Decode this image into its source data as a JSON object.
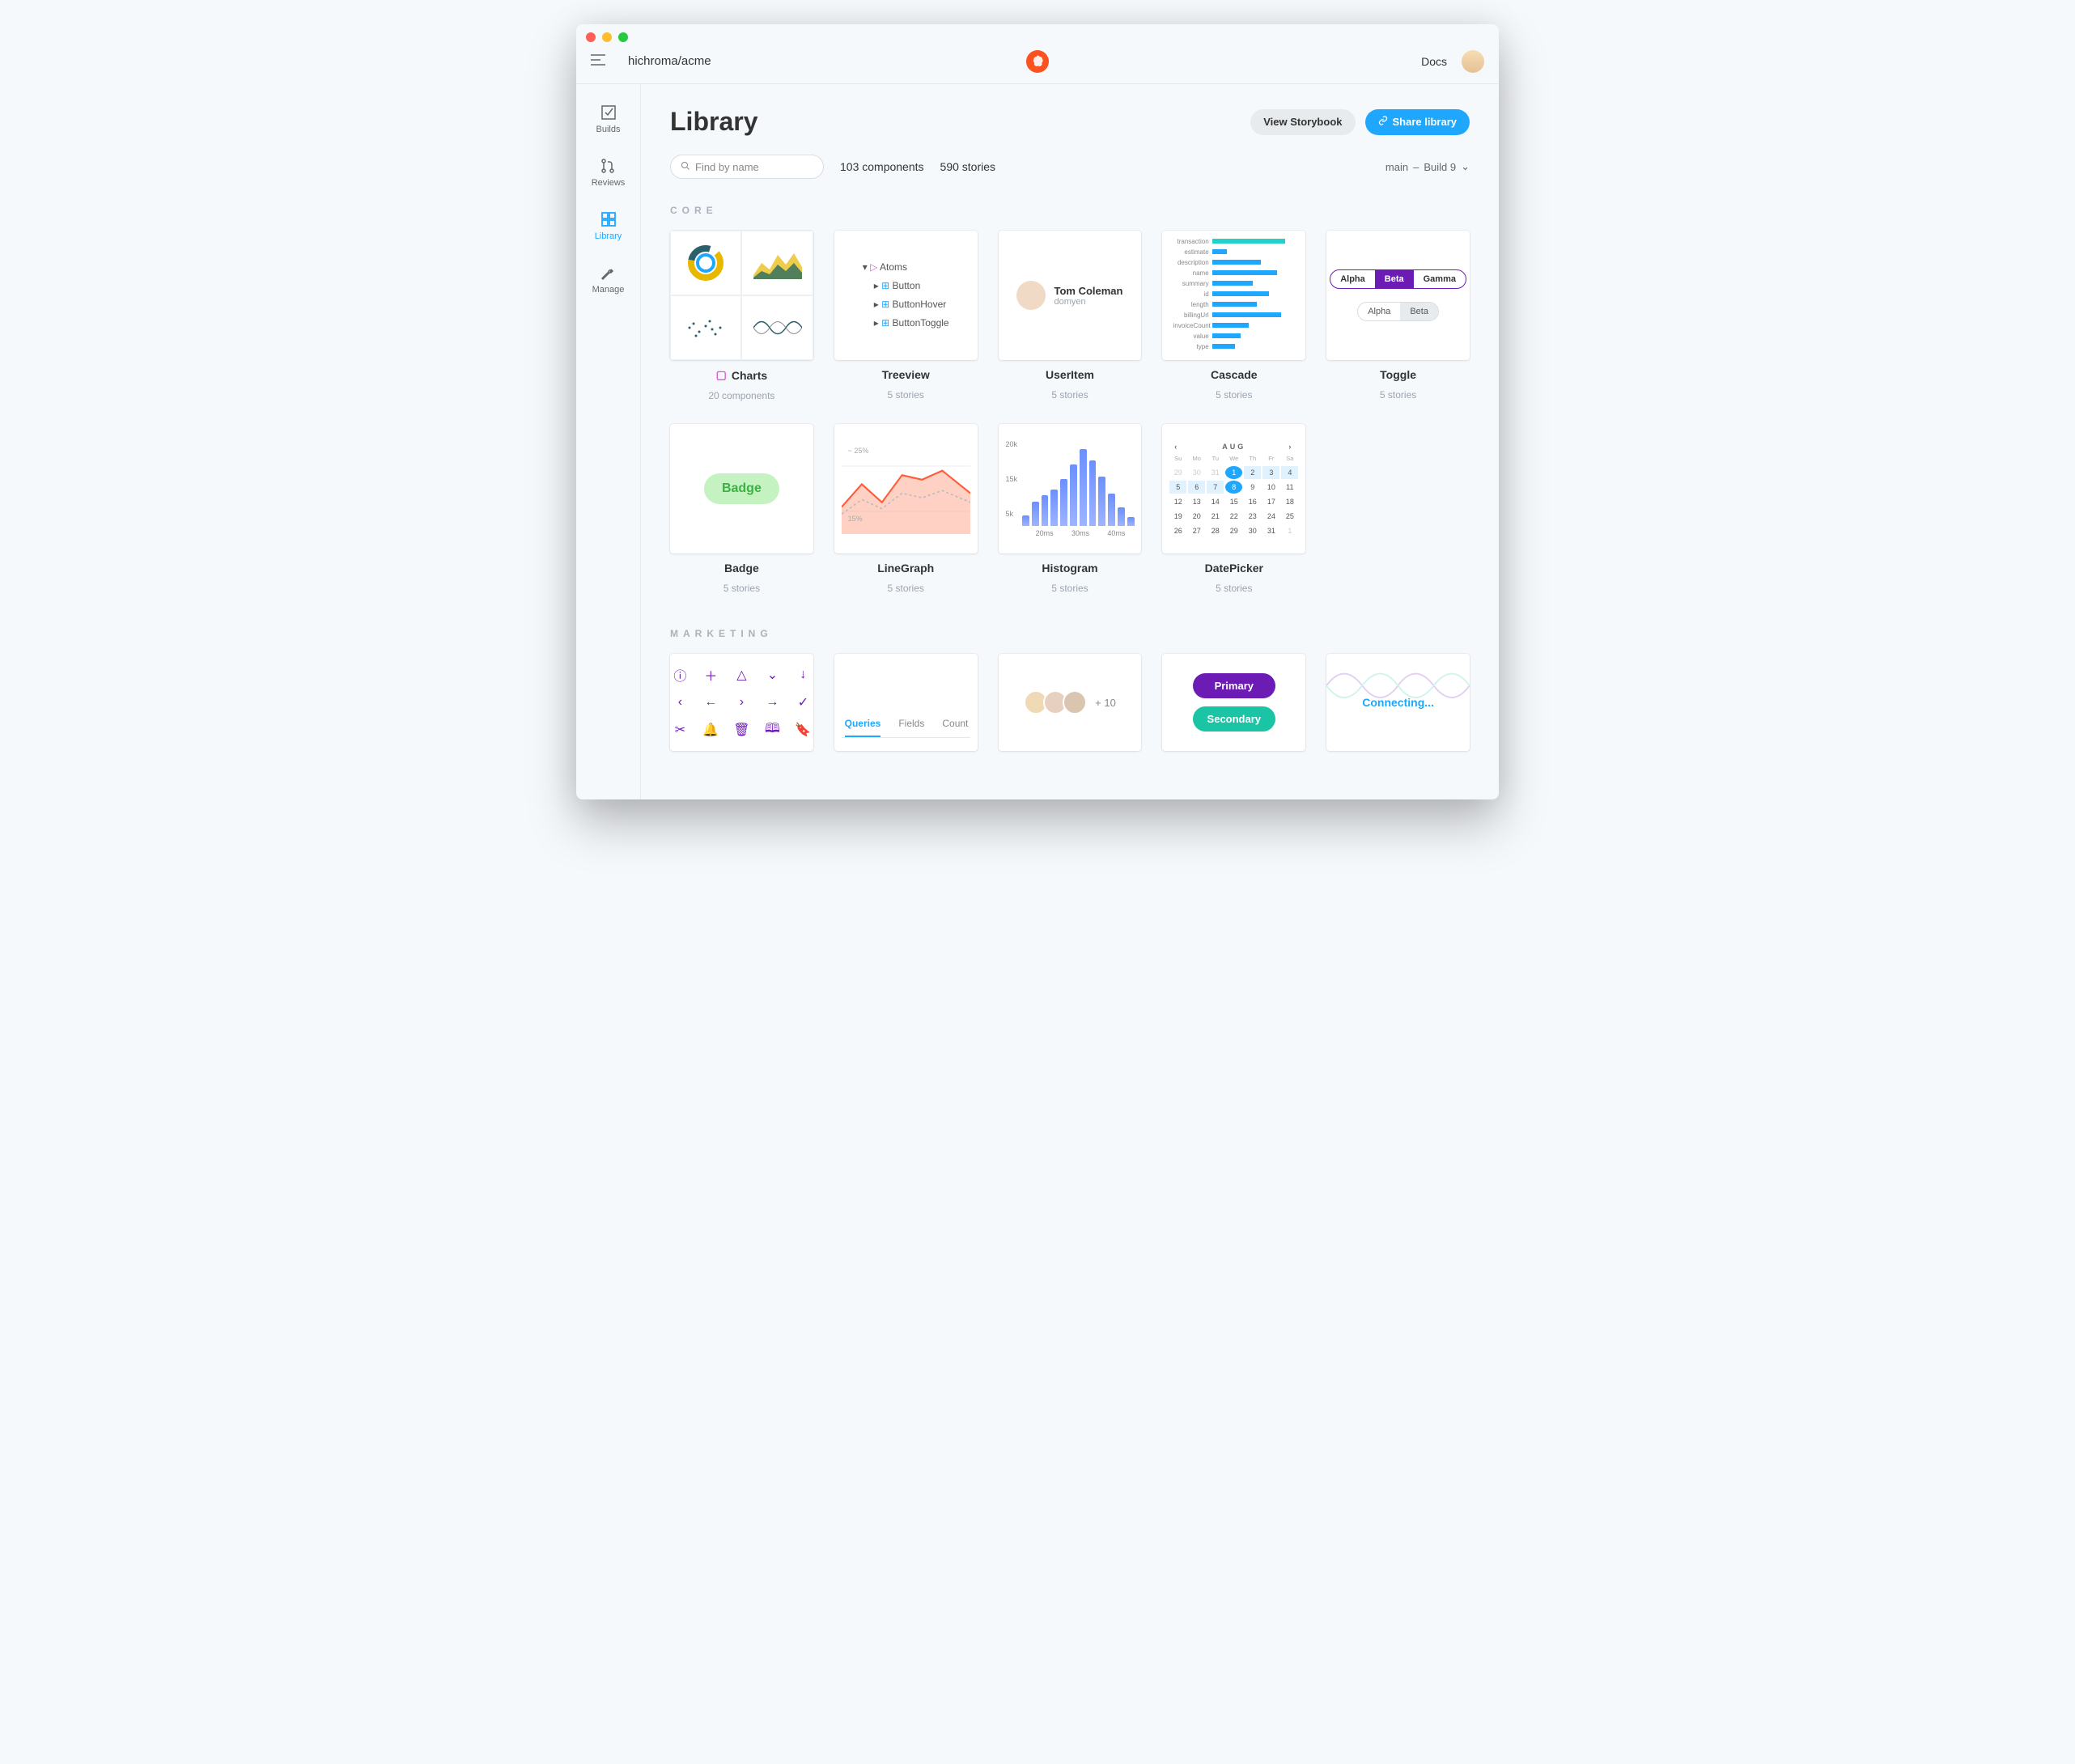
{
  "topbar": {
    "project": "hichroma/acme",
    "docs": "Docs"
  },
  "sidebar": {
    "items": [
      {
        "label": "Builds"
      },
      {
        "label": "Reviews"
      },
      {
        "label": "Library"
      },
      {
        "label": "Manage"
      }
    ]
  },
  "header": {
    "title": "Library",
    "view_storybook": "View Storybook",
    "share": "Share library"
  },
  "controls": {
    "search_placeholder": "Find by name",
    "components": "103 components",
    "stories": "590 stories",
    "branch": "main",
    "build": "Build 9"
  },
  "sections": {
    "core": "CORE",
    "marketing": "MARKETING"
  },
  "core_cards": {
    "charts": {
      "title": "Charts",
      "sub": "20 components"
    },
    "treeview": {
      "title": "Treeview",
      "sub": "5 stories",
      "root": "Atoms",
      "items": [
        "Button",
        "ButtonHover",
        "ButtonToggle"
      ]
    },
    "useritem": {
      "title": "UserItem",
      "sub": "5 stories",
      "name": "Tom Coleman",
      "handle": "domyen"
    },
    "cascade": {
      "title": "Cascade",
      "sub": "5 stories",
      "rows": [
        {
          "label": "transaction",
          "w": 90,
          "color": "#24d1c8"
        },
        {
          "label": "estimate",
          "w": 18
        },
        {
          "label": "description",
          "w": 60
        },
        {
          "label": "name",
          "w": 80
        },
        {
          "label": "summary",
          "w": 50
        },
        {
          "label": "id",
          "w": 70
        },
        {
          "label": "length",
          "w": 55
        },
        {
          "label": "billingUrl",
          "w": 85
        },
        {
          "label": "invoiceCount",
          "w": 45
        },
        {
          "label": "value",
          "w": 35
        },
        {
          "label": "type",
          "w": 28
        }
      ]
    },
    "toggle": {
      "title": "Toggle",
      "sub": "5 stories",
      "g1": [
        "Alpha",
        "Beta",
        "Gamma"
      ],
      "g1_sel": 1,
      "g2": [
        "Alpha",
        "Beta"
      ],
      "g2_sel": 1
    }
  },
  "core_cards2": {
    "badge": {
      "title": "Badge",
      "sub": "5 stories",
      "text": "Badge"
    },
    "linegraph": {
      "title": "LineGraph",
      "sub": "5 stories",
      "up": "~ 25%",
      "down": "15%"
    },
    "histogram": {
      "title": "Histogram",
      "sub": "5 stories",
      "y": [
        "20k",
        "15k",
        "5k"
      ],
      "x": [
        "20ms",
        "30ms",
        "40ms"
      ],
      "bars": [
        12,
        28,
        36,
        42,
        55,
        72,
        90,
        76,
        58,
        38,
        22,
        10
      ]
    },
    "datepicker": {
      "title": "DatePicker",
      "sub": "5 stories",
      "month": "AUG",
      "dow": [
        "Su",
        "Mo",
        "Tu",
        "We",
        "Th",
        "Fr",
        "Sa"
      ]
    }
  },
  "marketing": {
    "tabs": {
      "items": [
        "Queries",
        "Fields",
        "Count"
      ],
      "active": 0
    },
    "avatars": {
      "more": "+ 10"
    },
    "buttons": {
      "primary": "Primary",
      "secondary": "Secondary"
    },
    "connecting": "Connecting..."
  }
}
